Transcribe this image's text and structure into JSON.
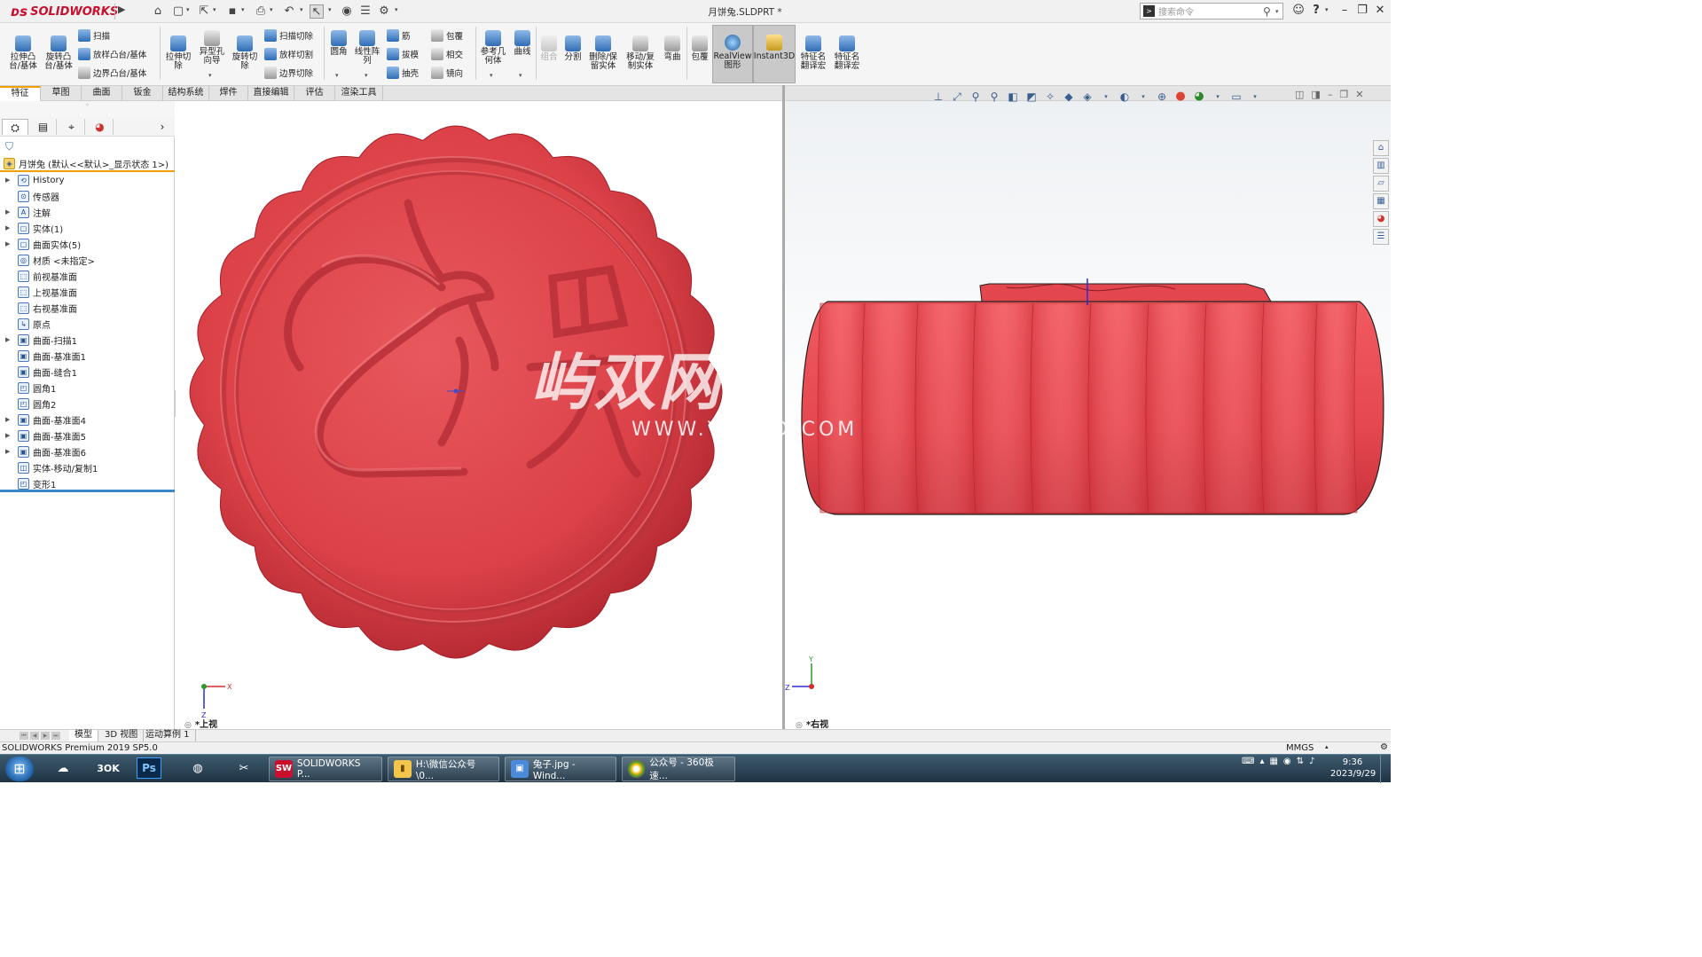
{
  "app": {
    "brand": "SOLIDWORKS",
    "file_title": "月饼兔.SLDPRT *",
    "search_placeholder": "搜索命令",
    "help": "?"
  },
  "ribbon": {
    "group1": [
      {
        "label": "拉伸凸\n台/基体",
        "icon": "extrude-boss-icon"
      },
      {
        "label": "旋转凸\n台/基体",
        "icon": "revolve-boss-icon"
      }
    ],
    "group1_small": [
      "扫描",
      "放样凸台/基体",
      "边界凸台/基体"
    ],
    "group2": [
      {
        "label": "拉伸切\n除",
        "icon": "extrude-cut-icon"
      },
      {
        "label": "异型孔\n向导",
        "icon": "hole-wizard-icon"
      },
      {
        "label": "旋转切\n除",
        "icon": "revolve-cut-icon"
      }
    ],
    "group2_small": [
      "扫描切除",
      "放样切割",
      "边界切除"
    ],
    "group3": [
      {
        "label": "圆角",
        "icon": "fillet-icon"
      },
      {
        "label": "线性阵\n列",
        "icon": "linear-pattern-icon"
      }
    ],
    "group3_small": [
      "筋",
      "拔模",
      "抽壳"
    ],
    "group3b_small": [
      "包覆",
      "相交",
      "镜向"
    ],
    "group4": [
      {
        "label": "参考几\n何体",
        "icon": "reference-geometry-icon"
      },
      {
        "label": "曲线",
        "icon": "curves-icon"
      }
    ],
    "group5": [
      {
        "label": "组合",
        "icon": "combine-icon",
        "disabled": true
      },
      {
        "label": "分割",
        "icon": "split-icon"
      },
      {
        "label": "删除/保\n留实体",
        "icon": "delete-body-icon"
      },
      {
        "label": "移动/复\n制实体",
        "icon": "move-copy-body-icon"
      },
      {
        "label": "弯曲",
        "icon": "flex-icon"
      }
    ],
    "group6": [
      {
        "label": "包覆",
        "icon": "wrap-icon"
      },
      {
        "label": "RealView\n图形",
        "icon": "realview-icon"
      },
      {
        "label": "Instant3D",
        "icon": "instant3d-icon"
      },
      {
        "label": "特征名\n翻译宏",
        "icon": "macro-icon"
      },
      {
        "label": "特征名\n翻译宏",
        "icon": "macro-icon-2"
      }
    ]
  },
  "tabs": [
    "特征",
    "草图",
    "曲面",
    "钣金",
    "结构系统",
    "焊件",
    "直接编辑",
    "评估",
    "渲染工具"
  ],
  "tree": {
    "root": "月饼兔  (默认<<默认>_显示状态 1>)",
    "items": [
      {
        "label": "History",
        "exp": true
      },
      {
        "label": "传感器",
        "exp": false
      },
      {
        "label": "注解",
        "exp": true
      },
      {
        "label": "实体(1)",
        "exp": true
      },
      {
        "label": "曲面实体(5)",
        "exp": true
      },
      {
        "label": "材质 <未指定>",
        "exp": false
      },
      {
        "label": "前视基准面",
        "exp": false
      },
      {
        "label": "上视基准面",
        "exp": false
      },
      {
        "label": "右视基准面",
        "exp": false
      },
      {
        "label": "原点",
        "exp": false
      },
      {
        "label": "曲面-扫描1",
        "exp": true
      },
      {
        "label": "曲面-基准面1",
        "exp": false
      },
      {
        "label": "曲面-缝合1",
        "exp": false
      },
      {
        "label": "圆角1",
        "exp": false
      },
      {
        "label": "圆角2",
        "exp": false
      },
      {
        "label": "曲面-基准面4",
        "exp": true
      },
      {
        "label": "曲面-基准面5",
        "exp": true
      },
      {
        "label": "曲面-基准面6",
        "exp": true
      },
      {
        "label": "实体-移动/复制1",
        "exp": false
      },
      {
        "label": "变形1",
        "exp": false
      }
    ]
  },
  "views": {
    "left_label": "*上视",
    "right_label": "*右视"
  },
  "watermark": {
    "main": "屿双网",
    "url": "WWW.YSH3D.COM"
  },
  "bottom_tabs": [
    "模型",
    "3D 视图",
    "运动算例 1"
  ],
  "status": {
    "text": "SOLIDWORKS Premium 2019 SP5.0",
    "units": "MMGS"
  },
  "taskbar": {
    "tasks": [
      {
        "label": "SOLIDWORKS P...",
        "icon": "SW"
      },
      {
        "label": "H:\\微信公众号\\0...",
        "icon": "folder"
      },
      {
        "label": "兔子.jpg - Wind...",
        "icon": "photo"
      },
      {
        "label": "公众号 - 360极速...",
        "icon": "browser"
      }
    ],
    "time": "9:36",
    "date": "2023/9/29"
  },
  "colors": {
    "part_red": "#e8454c",
    "accent_orange": "#f0a000"
  }
}
